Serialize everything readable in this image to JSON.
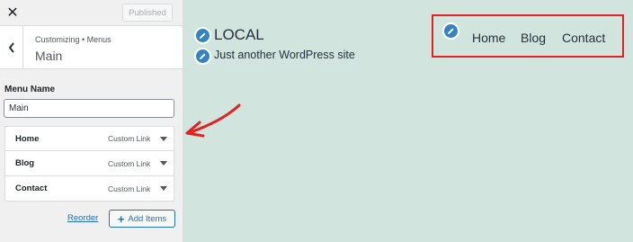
{
  "sidebar": {
    "close_glyph": "✕",
    "publish_button": "Published",
    "breadcrumb": "Customizing • Menus",
    "section_title": "Main",
    "menu_name_label": "Menu Name",
    "menu_name_value": "Main",
    "items": [
      {
        "title": "Home",
        "type": "Custom Link"
      },
      {
        "title": "Blog",
        "type": "Custom Link"
      },
      {
        "title": "Contact",
        "type": "Custom Link"
      }
    ],
    "reorder_label": "Reorder",
    "add_items_label": "Add Items"
  },
  "preview": {
    "site_title": "LOCAL",
    "tagline": "Just another WordPress site",
    "nav": [
      "Home",
      "Blog",
      "Contact"
    ]
  },
  "colors": {
    "preview_bg": "#d1e4dd",
    "accent": "#2271b1",
    "edit_shortcut": "#3582c4",
    "highlight": "#e02222"
  },
  "icons": [
    "close-icon",
    "chevron-left-icon",
    "pencil-icon",
    "chevron-down-icon",
    "plus-icon",
    "arrow-annotation"
  ]
}
